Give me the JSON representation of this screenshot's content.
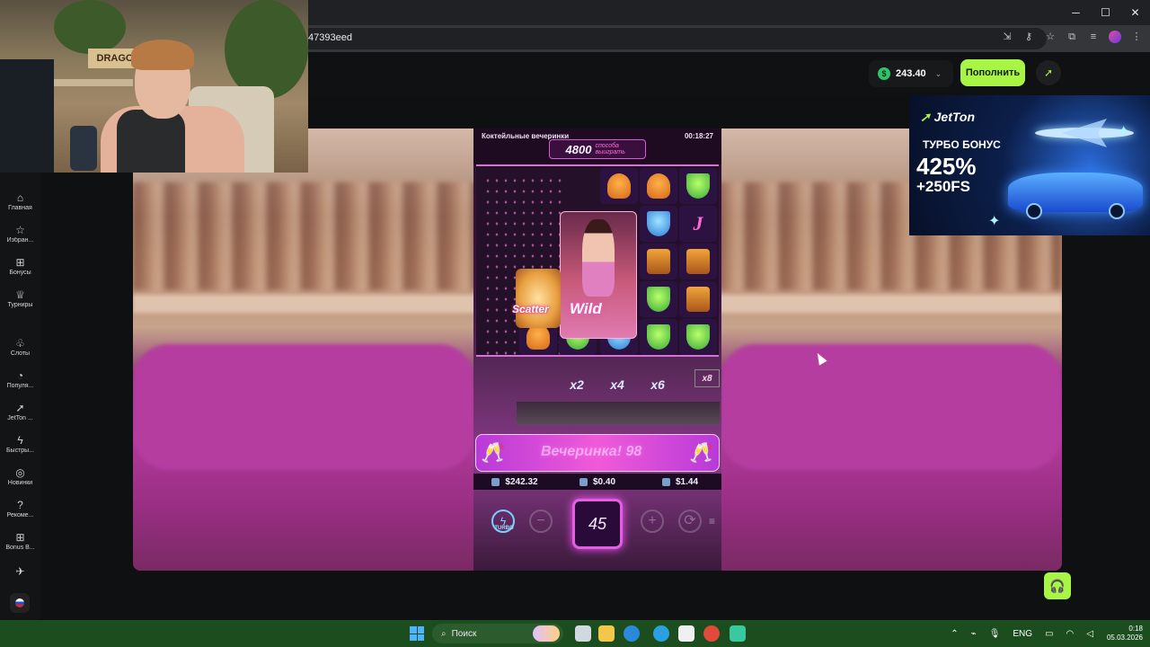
{
  "browser": {
    "url": "47393eed",
    "window_controls": [
      "─",
      "☐",
      "✕"
    ]
  },
  "header": {
    "balance": "243.40",
    "balance_currency_icon": "dollar-coin-icon",
    "deposit_label": "Пополнить",
    "accent_color": "#a9f545"
  },
  "sidebar": {
    "items": [
      {
        "label": "Главная",
        "icon": "⌂"
      },
      {
        "label": "Избран...",
        "icon": "☆"
      },
      {
        "label": "Бонусы",
        "icon": "⊞"
      },
      {
        "label": "Турниры",
        "icon": "♕"
      },
      {
        "label": "Слоты",
        "icon": "♧"
      },
      {
        "label": "Популя...",
        "icon": "◔"
      },
      {
        "label": "JetTon ...",
        "icon": "➚"
      },
      {
        "label": "Быстры...",
        "icon": "ϟ"
      },
      {
        "label": "Новинки",
        "icon": "◎"
      },
      {
        "label": "Рекоме...",
        "icon": "?"
      },
      {
        "label": "Bonus B...",
        "icon": "⊞"
      },
      {
        "label": "",
        "icon": "✈"
      }
    ]
  },
  "webcam": {
    "sign_text": "DRAGON"
  },
  "game": {
    "title": "Коктейльные вечеринки",
    "timer": "00:18:27",
    "ways": "4800",
    "ways_label": "способа выиграть",
    "wild_text": "Wild",
    "scatter_text": "Scatter",
    "multipliers": [
      "x2",
      "x4",
      "x6",
      "x8"
    ],
    "banner_text": "Вечеринка! 98",
    "stats": {
      "balance": "$242.32",
      "bet": "$0.40",
      "win": "$1.44"
    },
    "spin_count": "45",
    "turbo_label": "TURBO",
    "minus_label": "−",
    "plus_label": "+"
  },
  "ad": {
    "logo": "JetTon",
    "line1": "ТУРБО БОНУС",
    "line2": "425%",
    "line3": "+250FS"
  },
  "taskbar": {
    "search_label": "Поиск",
    "language": "ENG",
    "time": "0:18",
    "date": "05.03.2026"
  }
}
